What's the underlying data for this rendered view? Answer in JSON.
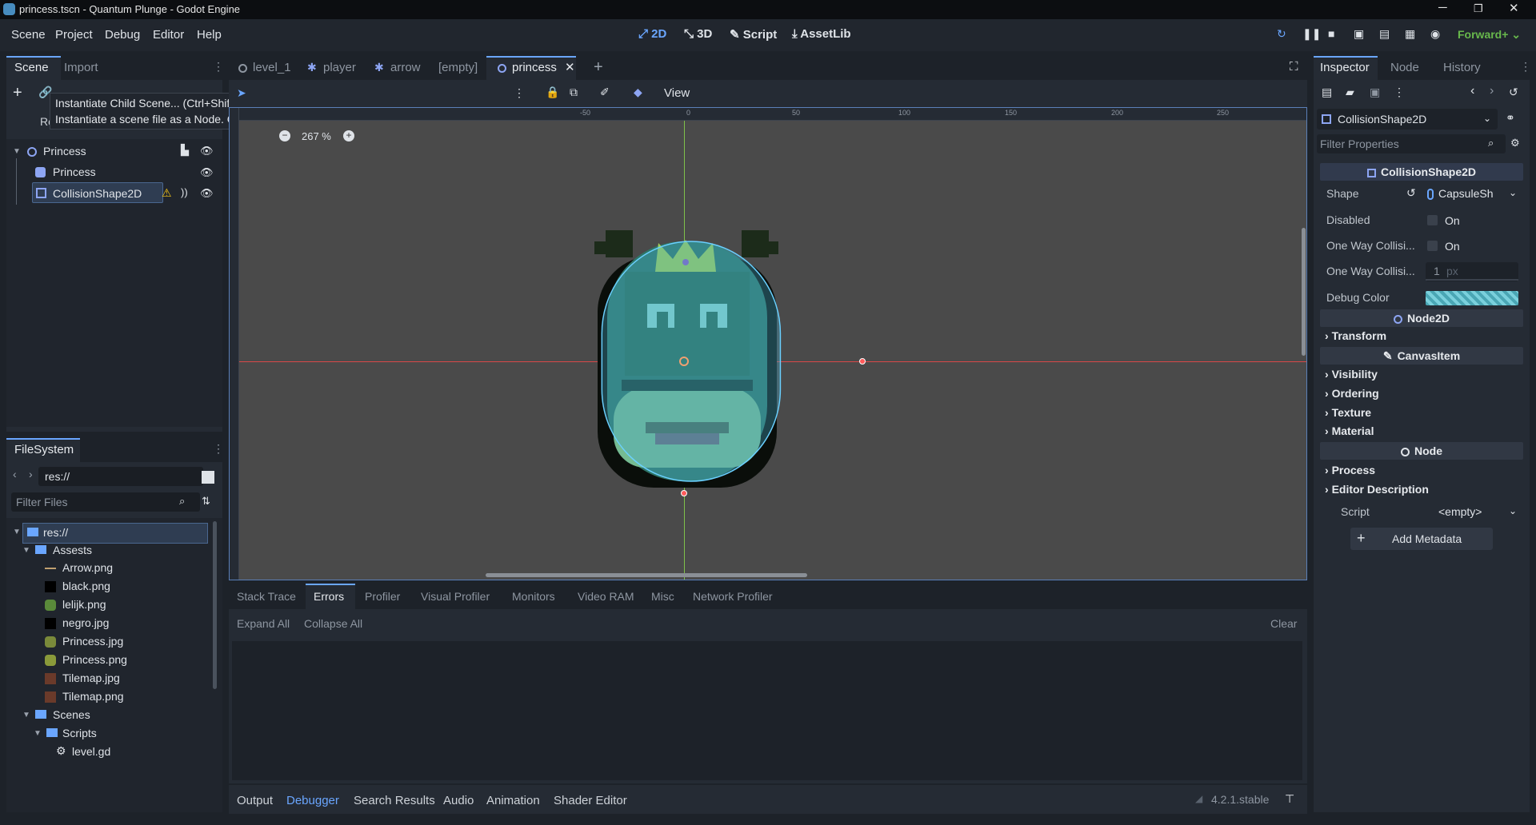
{
  "window": {
    "title": "princess.tscn - Quantum Plunge - Godot Engine"
  },
  "menu": [
    "Scene",
    "Project",
    "Debug",
    "Editor",
    "Help"
  ],
  "workspaces": [
    "2D",
    "3D",
    "Script",
    "AssetLib"
  ],
  "renderer": "Forward+",
  "scene_dock": {
    "tabs": [
      "Scene",
      "Import"
    ],
    "tooltip_title": "Instantiate Child Scene... (Ctrl+Shift+A)",
    "tooltip_desc": "Instantiate a scene file as a Node. Creates an inherited scene if no root node exists.",
    "tree": [
      {
        "label": "Princess"
      },
      {
        "label": "Princess"
      },
      {
        "label": "CollisionShape2D"
      }
    ]
  },
  "filesystem": {
    "tab": "FileSystem",
    "path": "res://",
    "filter_placeholder": "Filter Files",
    "items": [
      "res://",
      "Assests",
      "Arrow.png",
      "black.png",
      "lelijk.png",
      "negro.jpg",
      "Princess.jpg",
      "Princess.png",
      "Tilemap.jpg",
      "Tilemap.png",
      "Scenes",
      "Scripts",
      "level.gd"
    ]
  },
  "scene_tabs": [
    "level_1",
    "player",
    "arrow",
    "[empty]",
    "princess"
  ],
  "viewport": {
    "view_label": "View",
    "zoom": "267 %",
    "ruler_labels": [
      "-50",
      "0",
      "50",
      "100",
      "150",
      "200",
      "250"
    ]
  },
  "debugger": {
    "tabs": [
      "Stack Trace",
      "Errors",
      "Profiler",
      "Visual Profiler",
      "Monitors",
      "Video RAM",
      "Misc",
      "Network Profiler"
    ],
    "expand_all": "Expand All",
    "collapse_all": "Collapse All",
    "clear": "Clear"
  },
  "bottom_tabs": [
    "Output",
    "Debugger",
    "Search Results",
    "Audio",
    "Animation",
    "Shader Editor"
  ],
  "version": "4.2.1.stable",
  "inspector": {
    "tabs": [
      "Inspector",
      "Node",
      "History"
    ],
    "node": "CollisionShape2D",
    "filter_placeholder": "Filter Properties",
    "class_header": "CollisionShape2D",
    "shape_label": "Shape",
    "shape_value": "CapsuleSh",
    "disabled_label": "Disabled",
    "on": "On",
    "one_way_label": "One Way Collisi...",
    "one_way_margin_label": "One Way Collisi...",
    "one_way_margin_value": "1",
    "one_way_margin_unit": "px",
    "debug_color_label": "Debug Color",
    "node2d_header": "Node2D",
    "transform": "Transform",
    "canvasitem_header": "CanvasItem",
    "visibility": "Visibility",
    "ordering": "Ordering",
    "texture": "Texture",
    "material": "Material",
    "node_header": "Node",
    "process": "Process",
    "editor_description": "Editor Description",
    "script_label": "Script",
    "script_value": "<empty>",
    "add_metadata": "Add Metadata"
  },
  "colors": {
    "accent": "#6aa6ff",
    "renderer": "#68b84c",
    "warning": "#f5c518"
  }
}
